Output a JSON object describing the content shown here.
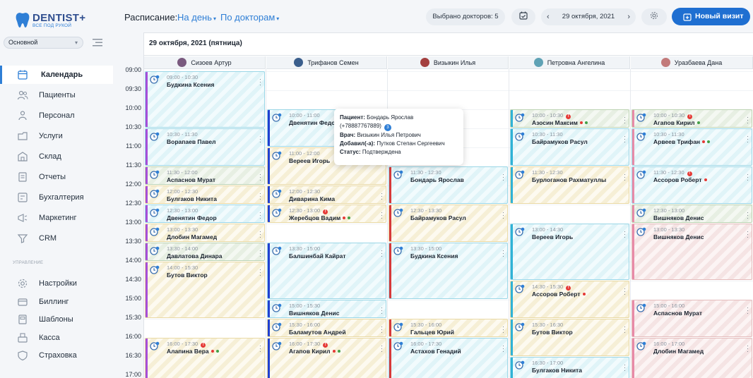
{
  "app": {
    "logo_main": "DENTIST+",
    "logo_sub": "ВСЕ ПОД РУКОЙ",
    "branch_selected": "Основной"
  },
  "sidebar": {
    "items": [
      {
        "label": "Календарь",
        "icon": "calendar-icon",
        "active": true
      },
      {
        "label": "Пациенты",
        "icon": "patients-icon"
      },
      {
        "label": "Персонал",
        "icon": "staff-icon"
      },
      {
        "label": "Услуги",
        "icon": "services-icon"
      },
      {
        "label": "Склад",
        "icon": "warehouse-icon"
      },
      {
        "label": "Отчеты",
        "icon": "reports-icon"
      },
      {
        "label": "Бухгалтерия",
        "icon": "accounting-icon"
      },
      {
        "label": "Маркетинг",
        "icon": "marketing-icon"
      },
      {
        "label": "CRM",
        "icon": "crm-icon"
      }
    ],
    "section_label": "УПРАВЛЕНИЕ",
    "admin_items": [
      {
        "label": "Настройки",
        "icon": "settings-icon"
      },
      {
        "label": "Биллинг",
        "icon": "billing-icon"
      },
      {
        "label": "Шаблоны",
        "icon": "templates-icon"
      },
      {
        "label": "Касса",
        "icon": "cashbox-icon"
      },
      {
        "label": "Страховка",
        "icon": "insurance-icon"
      }
    ]
  },
  "toolbar": {
    "title": "Расписание:",
    "view_day": "На день",
    "view_doctors": "По докторам",
    "selected_doctors": "Выбрано докторов: 5",
    "current_date": "29 октября, 2021",
    "new_visit": "Новый визит"
  },
  "calendar": {
    "date_header": "29 октября, 2021 (пятница)",
    "times": [
      "09:00",
      "09:30",
      "10:00",
      "10:30",
      "11:00",
      "11:30",
      "12:00",
      "12:30",
      "13:00",
      "13:30",
      "14:00",
      "14:30",
      "15:00",
      "15:30",
      "16:00",
      "16:30",
      "17:00"
    ],
    "doctors": [
      {
        "name": "Сизоев Артур",
        "avatar_color": "#7a5a7f"
      },
      {
        "name": "Трифанов Семен",
        "avatar_color": "#3a5e8c"
      },
      {
        "name": "Визыкин Илья",
        "avatar_color": "#a33f3f"
      },
      {
        "name": "Петровна Ангелина",
        "avatar_color": "#5fa2b5"
      },
      {
        "name": "Уразбаева Дана",
        "avatar_color": "#c27a7a"
      }
    ],
    "appointments": [
      {
        "col": 0,
        "start": "09:00",
        "end": "10:30",
        "time": "09:00 - 10:30",
        "name": "Будкина Ксения",
        "style": "cyan",
        "bar": "#a64ed8"
      },
      {
        "col": 0,
        "start": "10:30",
        "end": "11:30",
        "time": "10:30 - 11:30",
        "name": "Ворапаев Павел",
        "style": "cyan",
        "bar": "#a64ed8"
      },
      {
        "col": 0,
        "start": "11:30",
        "end": "12:00",
        "time": "11:30 - 12:00",
        "name": "Аспаснов Мурат",
        "style": "green",
        "bar": "#a64ed8"
      },
      {
        "col": 0,
        "start": "12:00",
        "end": "12:30",
        "time": "12:00 - 12:30",
        "name": "Булгаков Никита",
        "style": "yellow",
        "bar": "#a64ed8"
      },
      {
        "col": 0,
        "start": "12:30",
        "end": "13:00",
        "time": "12:30 - 13:00",
        "name": "Двенятин Федор",
        "style": "cyan",
        "bar": "#a64ed8"
      },
      {
        "col": 0,
        "start": "13:00",
        "end": "13:30",
        "time": "13:00 - 13:30",
        "name": "Длобин Магамед",
        "style": "yellow",
        "bar": "#a64ed8"
      },
      {
        "col": 0,
        "start": "13:30",
        "end": "14:00",
        "time": "13:30 - 14:00",
        "name": "Давлатова Динара",
        "style": "green",
        "bar": "#a64ed8"
      },
      {
        "col": 0,
        "start": "14:00",
        "end": "15:30",
        "time": "14:00 - 15:30",
        "name": "Бутов Виктор",
        "style": "yellow",
        "bar": "#a64ed8"
      },
      {
        "col": 0,
        "start": "16:00",
        "end": "17:30",
        "time": "16:00 - 17:30",
        "name": "Алапина Вера",
        "style": "yellow",
        "bar": "#a64ed8",
        "warn": true,
        "dots": [
          "#e53935",
          "#43a047"
        ]
      },
      {
        "col": 1,
        "start": "10:00",
        "end": "11:00",
        "time": "10:00 - 11:00",
        "name": "Двенятин Федор",
        "style": "cyan",
        "bar": "#1f3fd1"
      },
      {
        "col": 1,
        "start": "11:00",
        "end": "12:00",
        "time": "11:00 - 12:00",
        "name": "Вереев Игорь",
        "style": "yellow",
        "bar": "#1f3fd1"
      },
      {
        "col": 1,
        "start": "12:00",
        "end": "12:30",
        "time": "12:00 - 12:30",
        "name": "Диварина Кима",
        "style": "yellow",
        "bar": "#1f3fd1"
      },
      {
        "col": 1,
        "start": "12:30",
        "end": "13:00",
        "time": "12:30 - 13:00",
        "name": "Жеребцов Вадим",
        "style": "yellow",
        "bar": "#1f3fd1",
        "warn": true,
        "dots": [
          "#e53935",
          "#43a047"
        ]
      },
      {
        "col": 1,
        "start": "13:30",
        "end": "15:00",
        "time": "13:30 - 15:00",
        "name": "Балшинбай Кайрат",
        "style": "cyan",
        "bar": "#1f3fd1"
      },
      {
        "col": 1,
        "start": "15:00",
        "end": "15:30",
        "time": "15:00 - 15:30",
        "name": "Вишняков Денис",
        "style": "cyan",
        "bar": "#1f3fd1"
      },
      {
        "col": 1,
        "start": "15:30",
        "end": "16:00",
        "time": "15:30 - 16:00",
        "name": "Баламутов Андрей",
        "style": "yellow",
        "bar": "#1f3fd1"
      },
      {
        "col": 1,
        "start": "16:00",
        "end": "17:30",
        "time": "16:00 - 17:30",
        "name": "Агапов Кирил",
        "style": "yellow",
        "bar": "#1f3fd1",
        "warn": true,
        "dots": [
          "#e53935",
          "#43a047"
        ]
      },
      {
        "col": 2,
        "start": "11:30",
        "end": "12:30",
        "time": "11:30 - 12:30",
        "name": "Бондарь Ярослав",
        "style": "cyan",
        "bar": "#d63a3a"
      },
      {
        "col": 2,
        "start": "12:30",
        "end": "13:30",
        "time": "12:30 - 13:30",
        "name": "Байрамуков Расул",
        "style": "yellow",
        "bar": "#d63a3a"
      },
      {
        "col": 2,
        "start": "13:30",
        "end": "15:00",
        "time": "13:30 - 15:00",
        "name": "Будкина Ксения",
        "style": "cyan",
        "bar": "#d63a3a"
      },
      {
        "col": 2,
        "start": "15:30",
        "end": "16:00",
        "time": "15:30 - 16:00",
        "name": "Гальцев Юрий",
        "style": "yellow",
        "bar": "#d63a3a"
      },
      {
        "col": 2,
        "start": "16:00",
        "end": "17:30",
        "time": "16:00 - 17:30",
        "name": "Астахов Генадий",
        "style": "cyan",
        "bar": "#d63a3a"
      },
      {
        "col": 3,
        "start": "10:00",
        "end": "10:30",
        "time": "10:00 - 10:30",
        "name": "Азосин Максим",
        "style": "green",
        "bar": "#2fb2d6",
        "warn": true,
        "dots": [
          "#e53935",
          "#43a047"
        ]
      },
      {
        "col": 3,
        "start": "10:30",
        "end": "11:30",
        "time": "10:30 - 11:30",
        "name": "Байрамуков Расул",
        "style": "cyan",
        "bar": "#2fb2d6"
      },
      {
        "col": 3,
        "start": "11:30",
        "end": "12:30",
        "time": "11:30 - 12:30",
        "name": "Бурлоганов Рахматуллы",
        "style": "yellow",
        "bar": "#2fb2d6"
      },
      {
        "col": 3,
        "start": "13:00",
        "end": "14:30",
        "time": "13:00 - 14:30",
        "name": "Вереев Игорь",
        "style": "cyan",
        "bar": "#2fb2d6"
      },
      {
        "col": 3,
        "start": "14:30",
        "end": "15:30",
        "time": "14:30 - 15:30",
        "name": "Ассоров Роберт",
        "style": "yellow",
        "bar": "#2fb2d6",
        "warn": true,
        "dots": [
          "#e53935"
        ]
      },
      {
        "col": 3,
        "start": "15:30",
        "end": "16:30",
        "time": "15:30 - 16:30",
        "name": "Бутов Виктор",
        "style": "yellow",
        "bar": "#2fb2d6"
      },
      {
        "col": 3,
        "start": "16:30",
        "end": "17:30",
        "time": "16:30 - 17:00",
        "name": "Булгаков Никита",
        "style": "cyan",
        "bar": "#2fb2d6"
      },
      {
        "col": 4,
        "start": "10:00",
        "end": "10:30",
        "time": "10:00 - 10:30",
        "name": "Агапов Кирил",
        "style": "green",
        "bar": "#e88ba8",
        "warn": true,
        "dots": [
          "#43a047"
        ]
      },
      {
        "col": 4,
        "start": "10:30",
        "end": "11:30",
        "time": "10:30 - 11:30",
        "name": "Арвеев Трифан",
        "style": "cyan",
        "bar": "#e88ba8",
        "dots": [
          "#e53935",
          "#43a047"
        ]
      },
      {
        "col": 4,
        "start": "11:30",
        "end": "12:30",
        "time": "11:30 - 12:30",
        "name": "Ассоров Роберт",
        "style": "cyan",
        "bar": "#e88ba8",
        "warn": true,
        "dots": [
          "#e53935"
        ]
      },
      {
        "col": 4,
        "start": "12:30",
        "end": "13:00",
        "time": "12:30 - 13:00",
        "name": "Вишняков Денис",
        "style": "green",
        "bar": "#e88ba8"
      },
      {
        "col": 4,
        "start": "13:00",
        "end": "14:30",
        "time": "13:00 - 13:30",
        "name": "Вишняков Денис",
        "style": "red",
        "bar": "#e88ba8"
      },
      {
        "col": 4,
        "start": "15:00",
        "end": "16:00",
        "time": "15:00 - 16:00",
        "name": "Аспаснов Мурат",
        "style": "red",
        "bar": "#e88ba8"
      },
      {
        "col": 4,
        "start": "16:00",
        "end": "17:30",
        "time": "16:00 - 17:00",
        "name": "Длобин Магамед",
        "style": "red",
        "bar": "#e88ba8"
      }
    ]
  },
  "popup": {
    "patient_label": "Пациент:",
    "patient_value": "Бондарь Ярослав",
    "phone": "(+78887767889)",
    "badge": "3",
    "doctor_label": "Врач:",
    "doctor_value": "Визыкин Илья Петрович",
    "added_label": "Добавил(-а):",
    "added_value": "Путков Степан Сергеевич",
    "status_label": "Статус:",
    "status_value": "Подтверждена"
  }
}
